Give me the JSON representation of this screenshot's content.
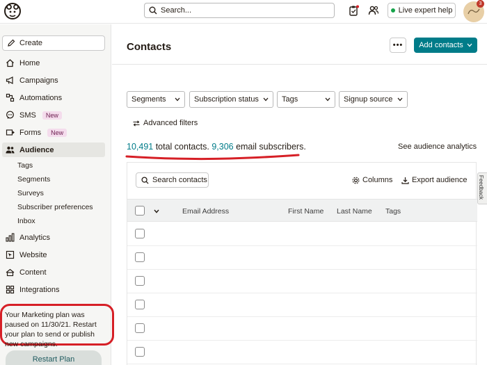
{
  "topbar": {
    "search_placeholder": "Search...",
    "expert_label": "Live expert help",
    "notification_count": "3"
  },
  "sidebar": {
    "create_label": "Create",
    "items": [
      {
        "label": "Home",
        "icon": "home-icon"
      },
      {
        "label": "Campaigns",
        "icon": "megaphone-icon"
      },
      {
        "label": "Automations",
        "icon": "automation-icon"
      },
      {
        "label": "SMS",
        "icon": "sms-icon",
        "badge": "New"
      },
      {
        "label": "Forms",
        "icon": "forms-icon",
        "badge": "New"
      },
      {
        "label": "Audience",
        "icon": "audience-icon",
        "active": true
      },
      {
        "label": "Analytics",
        "icon": "analytics-icon"
      },
      {
        "label": "Website",
        "icon": "website-icon"
      },
      {
        "label": "Content",
        "icon": "content-icon"
      },
      {
        "label": "Integrations",
        "icon": "integrations-icon"
      }
    ],
    "sub_items": [
      "Tags",
      "Segments",
      "Surveys",
      "Subscriber preferences",
      "Inbox"
    ],
    "paused_notice": "Your Marketing plan was paused on 11/30/21. Restart your plan to send or publish new campaigns.",
    "restart_label": "Restart Plan"
  },
  "header": {
    "title": "Contacts",
    "more_label": "•••",
    "add_label": "Add contacts"
  },
  "filters": {
    "dropdowns": [
      "Segments",
      "Subscription status",
      "Tags",
      "Signup source"
    ],
    "advanced_label": "Advanced filters"
  },
  "totals": {
    "total_count": "10,491",
    "total_text": " total contacts. ",
    "email_count": "9,306",
    "email_text": " email subscribers."
  },
  "audience_link": "See audience analytics",
  "table": {
    "search_label": "Search contacts",
    "columns_label": "Columns",
    "export_label": "Export audience",
    "headers": [
      "Email Address",
      "First Name",
      "Last Name",
      "Tags"
    ]
  },
  "feedback_label": "Feedback",
  "colors": {
    "accent": "#007c89",
    "highlight_red": "#d61f26"
  }
}
